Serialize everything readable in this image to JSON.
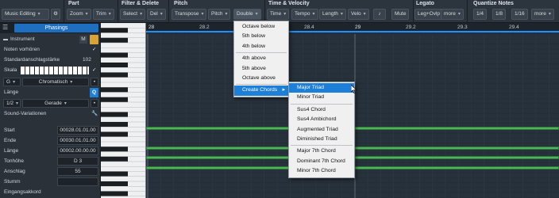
{
  "toolbar": {
    "mode": "Music Editing",
    "sections": {
      "part": "Part",
      "filter": "Filter & Delete",
      "pitch": "Pitch",
      "time": "Time & Velocity",
      "legato": "Legato",
      "quantize": "Quantize Notes"
    },
    "buttons": {
      "zoom": "Zoom",
      "trim": "Trim",
      "select": "Select",
      "del": "Del",
      "transpose": "Transpose",
      "pitch": "Pitch",
      "double": "Double",
      "time": "Time",
      "tempo": "Tempo",
      "length": "Length",
      "velo": "Velo",
      "mute": "Mute",
      "legovlp": "Leg+Ovlp",
      "more1": "more",
      "q14": "1/4",
      "q18": "1/8",
      "q116": "1/16",
      "more2": "more"
    }
  },
  "inspector": {
    "title": "Phasings",
    "instrument": "Instrument",
    "notes_hint": "Noten vorhören",
    "default_length": "Standardanschlagstärke",
    "default_length_value": "102",
    "scale": "Skala",
    "scale_key": "G",
    "scale_type": "Chromatisch",
    "length": "Länge",
    "length_value": "1/2",
    "length_type": "Gerade",
    "sound_variations": "Sound-Variationen",
    "start": "Start",
    "start_value": "00028.01.01.00",
    "end": "Ende",
    "end_value": "00030.01.01.00",
    "note_length": "Länge",
    "note_length_value": "00002.00.00.00",
    "pitch": "Tonhöhe",
    "pitch_value": "D 3",
    "velocity": "Anschlag",
    "velocity_value": "55",
    "mute": "Stumm",
    "input_chord": "Eingangsakkord"
  },
  "ruler": {
    "labels": [
      "28",
      "28.2",
      "28.4",
      "29",
      "29.2",
      "29.3",
      "29.4"
    ]
  },
  "menu_double": {
    "items": [
      "Octave below",
      "5th below",
      "4th below",
      "4th above",
      "5th above",
      "Octave above",
      "Create Chords"
    ]
  },
  "menu_chords": {
    "items": [
      "Major Triad",
      "Minor Triad",
      "Sus4 Chord",
      "Sus4 Ambichord",
      "Augmented Triad",
      "Diminished Triad",
      "Major 7th Chord",
      "Dominant 7th Chord",
      "Minor 7th Chord"
    ]
  },
  "colors": {
    "accent": "#1e7fd8",
    "note": "#4fb35a",
    "ruler_line": "#1e90ff"
  }
}
